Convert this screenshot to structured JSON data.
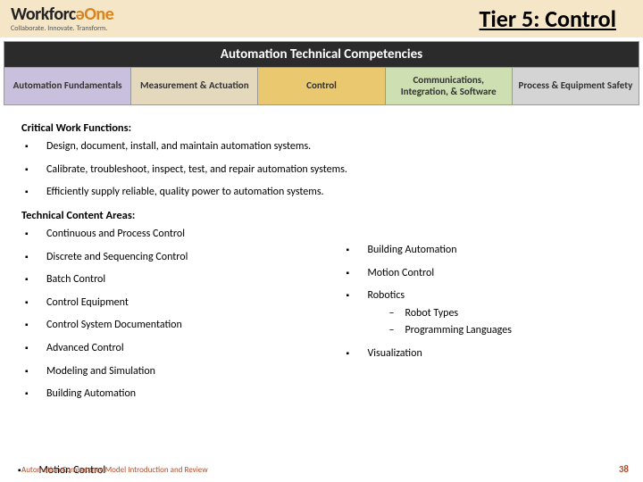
{
  "header": {
    "logo_main_a": "Workforc",
    "logo_main_b": "One",
    "logo_tag": "Collaborate.  Innovate.  Transform.",
    "title": "Tier 5: Control"
  },
  "banner": {
    "title": "Automation Technical Competencies",
    "tabs": [
      "Automation Fundamentals",
      "Measurement & Actuation",
      "Control",
      "Communications, Integration, & Software",
      "Process & Equipment Safety"
    ]
  },
  "sections": {
    "cwf_h": "Critical Work Functions:",
    "cwf": [
      "Design, document, install, and maintain automation systems.",
      "Calibrate, troubleshoot, inspect, test, and repair automation systems.",
      "Efficiently supply reliable, quality power to automation systems."
    ],
    "tca_h": "Technical Content Areas:",
    "tca_left": [
      "Continuous and Process Control",
      "Discrete and Sequencing Control",
      "Batch Control",
      "Control Equipment",
      "Control System Documentation",
      "Advanced Control",
      "Modeling and Simulation",
      "Building Automation"
    ],
    "tca_overflow": "Motion Control",
    "tca_right": {
      "r1": "Building Automation",
      "r2": "Motion Control",
      "r3": "Robotics",
      "r3a": "Robot Types",
      "r3b": "Programming Languages",
      "r4": "Visualization"
    }
  },
  "footer": {
    "left": "Automation Competency Model Introduction and Review",
    "page": "38"
  }
}
